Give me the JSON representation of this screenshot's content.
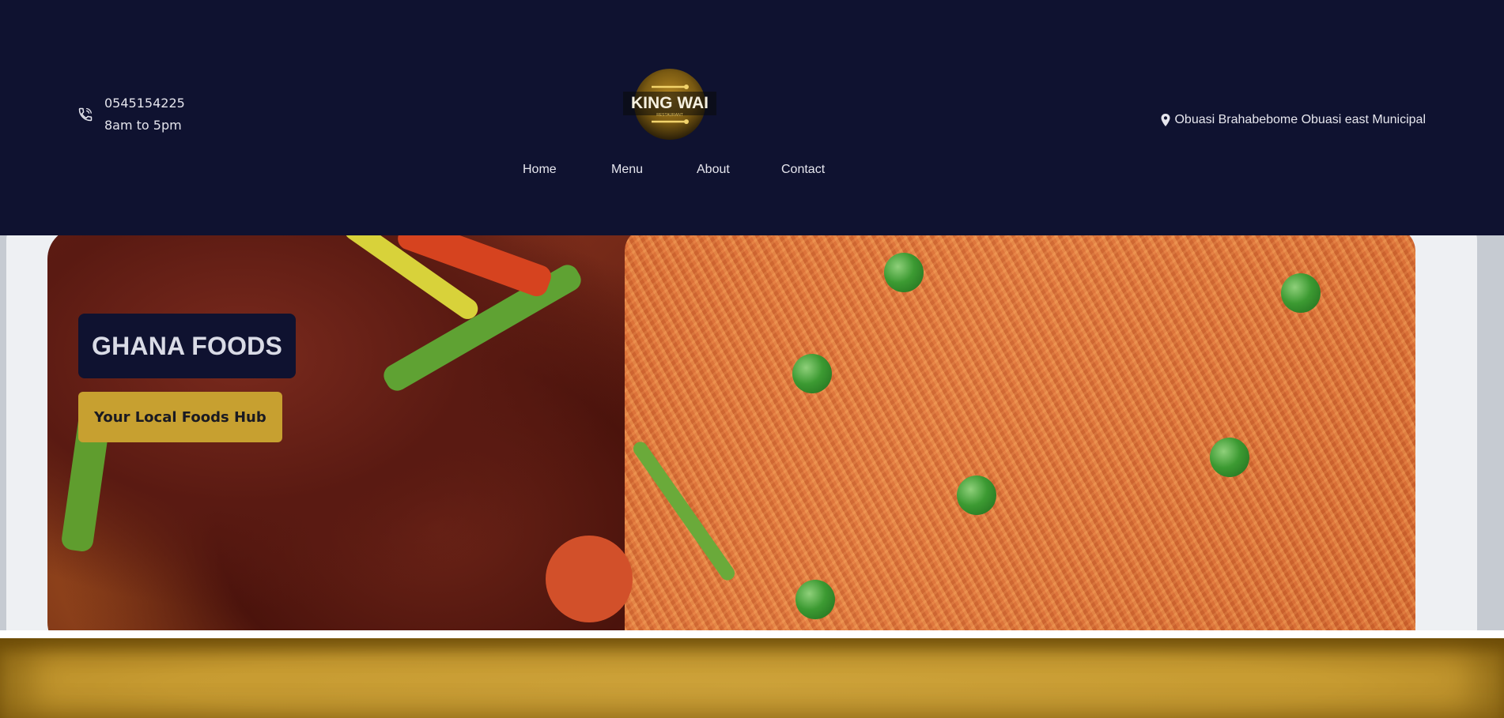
{
  "header": {
    "phone": "0545154225",
    "hours": "8am to 5pm",
    "address": "Obuasi Brahabebome Obuasi east Municipal",
    "logo": {
      "main_text": "KING WAI",
      "sub_text": "RESTAURANT"
    },
    "nav": [
      {
        "label": "Home"
      },
      {
        "label": "Menu"
      },
      {
        "label": "About"
      },
      {
        "label": "Contact"
      }
    ]
  },
  "hero": {
    "title": "GHANA FOODS",
    "subtitle": "Your Local Foods Hub"
  },
  "icons": {
    "phone": "phone-icon",
    "location": "map-pin-icon",
    "logo": "restaurant-logo"
  },
  "colors": {
    "header_bg": "#0f1230",
    "accent_gold": "#c7a030",
    "text_light": "#e6e6ee"
  }
}
